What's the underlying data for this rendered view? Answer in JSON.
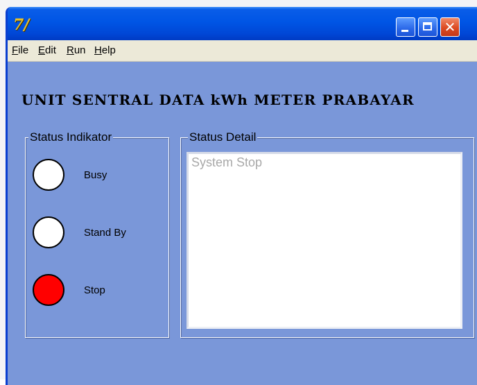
{
  "app": {
    "logo_text": "7/"
  },
  "menu": [
    {
      "label": "File",
      "accel": "F",
      "rest": "ile"
    },
    {
      "label": "Edit",
      "accel": "E",
      "rest": "dit"
    },
    {
      "label": "Run",
      "accel": "R",
      "rest": "un"
    },
    {
      "label": "Help",
      "accel": "H",
      "rest": "elp"
    }
  ],
  "main_title": "UNIT SENTRAL DATA kWh METER PRABAYAR",
  "indicator_group": {
    "caption": "Status Indikator",
    "items": [
      {
        "label": "Busy",
        "color": "#ffffff",
        "active": false
      },
      {
        "label": "Stand By",
        "color": "#ffffff",
        "active": false
      },
      {
        "label": "Stop",
        "color": "#ff0000",
        "active": true
      }
    ]
  },
  "detail_group": {
    "caption": "Status Detail",
    "text": "System Stop"
  },
  "colors": {
    "window_bg": "#7a97d9",
    "titlebar": "#0055e5",
    "menubar": "#ece9d8",
    "led_off": "#ffffff",
    "led_stop": "#ff0000"
  }
}
